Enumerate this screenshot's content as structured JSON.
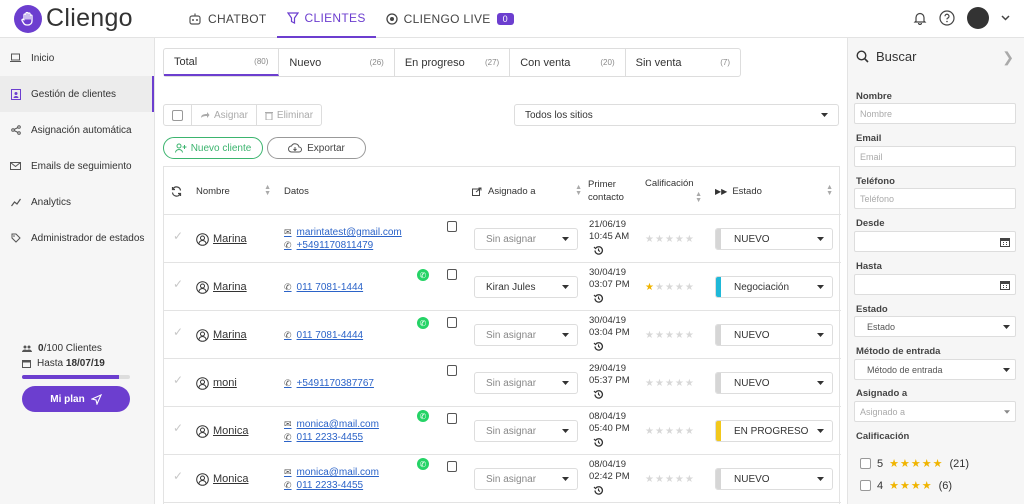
{
  "brand": "Cliengo",
  "nav": {
    "chatbot": "CHATBOT",
    "clientes": "CLIENTES",
    "live": "CLIENGO LIVE",
    "live_count": "0"
  },
  "sidebar": {
    "items": [
      {
        "label": "Inicio",
        "icon": "laptop-icon"
      },
      {
        "label": "Gestión de clientes",
        "icon": "contacts-icon"
      },
      {
        "label": "Asignación automática",
        "icon": "share-icon"
      },
      {
        "label": "Emails de seguimiento",
        "icon": "mail-icon"
      },
      {
        "label": "Analytics",
        "icon": "chart-icon"
      },
      {
        "label": "Administrador de estados",
        "icon": "tag-icon"
      }
    ],
    "plan": {
      "clients_strong": "0",
      "clients_rest": "/100 Clientes",
      "until_label": "Hasta",
      "until_date": "18/07/19",
      "progress": 0.9,
      "button": "Mi plan"
    }
  },
  "tabs": [
    {
      "label": "Total",
      "count": "(80)"
    },
    {
      "label": "Nuevo",
      "count": "(26)"
    },
    {
      "label": "En progreso",
      "count": "(27)"
    },
    {
      "label": "Con venta",
      "count": "(20)"
    },
    {
      "label": "Sin venta",
      "count": "(7)"
    }
  ],
  "toolbar": {
    "assign": "Asignar",
    "delete": "Eliminar",
    "sites": "Todos los sitios",
    "new_client": "Nuevo cliente",
    "export": "Exportar"
  },
  "table": {
    "headers": {
      "name": "Nombre",
      "data": "Datos",
      "assigned": "Asignado a",
      "first_contact_1": "Primer",
      "first_contact_2": "contacto",
      "rating": "Calificación",
      "state": "Estado"
    },
    "rows": [
      {
        "name": "Marina",
        "email": "marintatest@gmail.com",
        "phone": "+5491170811479",
        "whatsapp": false,
        "assigned": "Sin asignar",
        "date": "21/06/19",
        "time": "10:45 AM",
        "stars": 0,
        "state": "NUEVO",
        "state_color": "#d6d6d6"
      },
      {
        "name": "Marina",
        "email": "",
        "phone": "011 7081-1444",
        "whatsapp": true,
        "assigned": "Kiran Jules",
        "date": "30/04/19",
        "time": "03:07 PM",
        "stars": 1,
        "state": "Negociación",
        "state_color": "#1fb8d8"
      },
      {
        "name": "Marina",
        "email": "",
        "phone": "011 7081-4444",
        "whatsapp": true,
        "assigned": "Sin asignar",
        "date": "30/04/19",
        "time": "03:04 PM",
        "stars": 0,
        "state": "NUEVO",
        "state_color": "#d6d6d6"
      },
      {
        "name": "moni",
        "email": "",
        "phone": "+5491170387767",
        "whatsapp": false,
        "assigned": "Sin asignar",
        "date": "29/04/19",
        "time": "05:37 PM",
        "stars": 0,
        "state": "NUEVO",
        "state_color": "#d6d6d6"
      },
      {
        "name": "Monica",
        "email": "monica@mail.com",
        "phone": "011 2233-4455",
        "whatsapp": true,
        "assigned": "Sin asignar",
        "date": "08/04/19",
        "time": "05:40 PM",
        "stars": 0,
        "state": "EN PROGRESO",
        "state_color": "#f2c81c"
      },
      {
        "name": "Monica",
        "email": "monica@mail.com",
        "phone": "011 2233-4455",
        "whatsapp": true,
        "assigned": "Sin asignar",
        "date": "08/04/19",
        "time": "02:42 PM",
        "stars": 0,
        "state": "NUEVO",
        "state_color": "#d6d6d6"
      }
    ]
  },
  "filters": {
    "search": "Buscar",
    "nombre_label": "Nombre",
    "nombre_ph": "Nombre",
    "email_label": "Email",
    "email_ph": "Email",
    "telefono_label": "Teléfono",
    "telefono_ph": "Teléfono",
    "desde_label": "Desde",
    "hasta_label": "Hasta",
    "estado_label": "Estado",
    "estado_value": "Estado",
    "metodo_label": "Método de entrada",
    "metodo_value": "Método de entrada",
    "asignado_label": "Asignado a",
    "asignado_ph": "Asignado a",
    "calificacion_label": "Calificación",
    "ratings": [
      {
        "n": "5",
        "stars": "★★★★★",
        "count": "(21)"
      },
      {
        "n": "4",
        "stars": "★★★★",
        "count": "(6)"
      }
    ]
  }
}
